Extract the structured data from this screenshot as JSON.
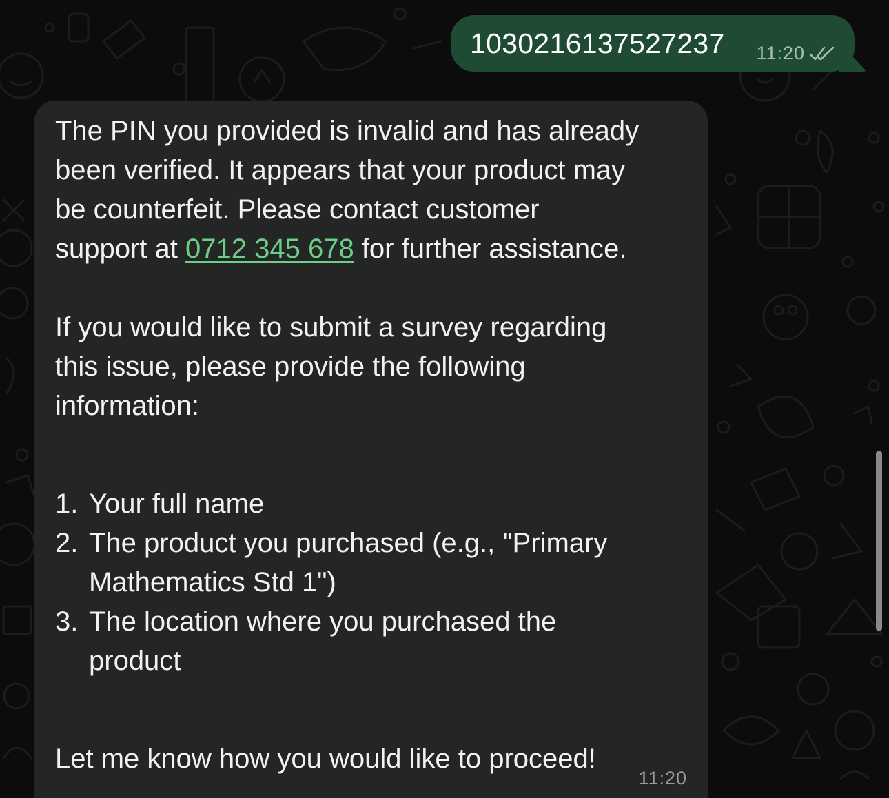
{
  "outgoing": {
    "text": "1030216137527237",
    "time": "11:20",
    "status_icon": "double-check-icon"
  },
  "incoming": {
    "line1": "The PIN you provided is invalid and has already",
    "line2": "been verified. It appears that your product may",
    "line3": "be counterfeit. Please contact customer",
    "line4_before": "support at ",
    "phone": "0712 345 678",
    "line4_after": " for further assistance.",
    "para2_line1": "If you would like to submit a survey regarding",
    "para2_line2": "this issue, please provide the following",
    "para2_line3": "information:",
    "items": [
      {
        "num": "1.",
        "line1": "Your full name",
        "line2": ""
      },
      {
        "num": "2.",
        "line1": "The product you purchased (e.g., \"Primary",
        "line2": "Mathematics Std 1\")"
      },
      {
        "num": "3.",
        "line1": "The location where you purchased the",
        "line2": "product"
      }
    ],
    "closing": "Let me know how you would like to proceed!",
    "time": "11:20"
  },
  "colors": {
    "outgoing_bubble": "#1f4a34",
    "incoming_bubble": "#242626",
    "link": "#6ccf86",
    "background": "#0c0c0c"
  }
}
